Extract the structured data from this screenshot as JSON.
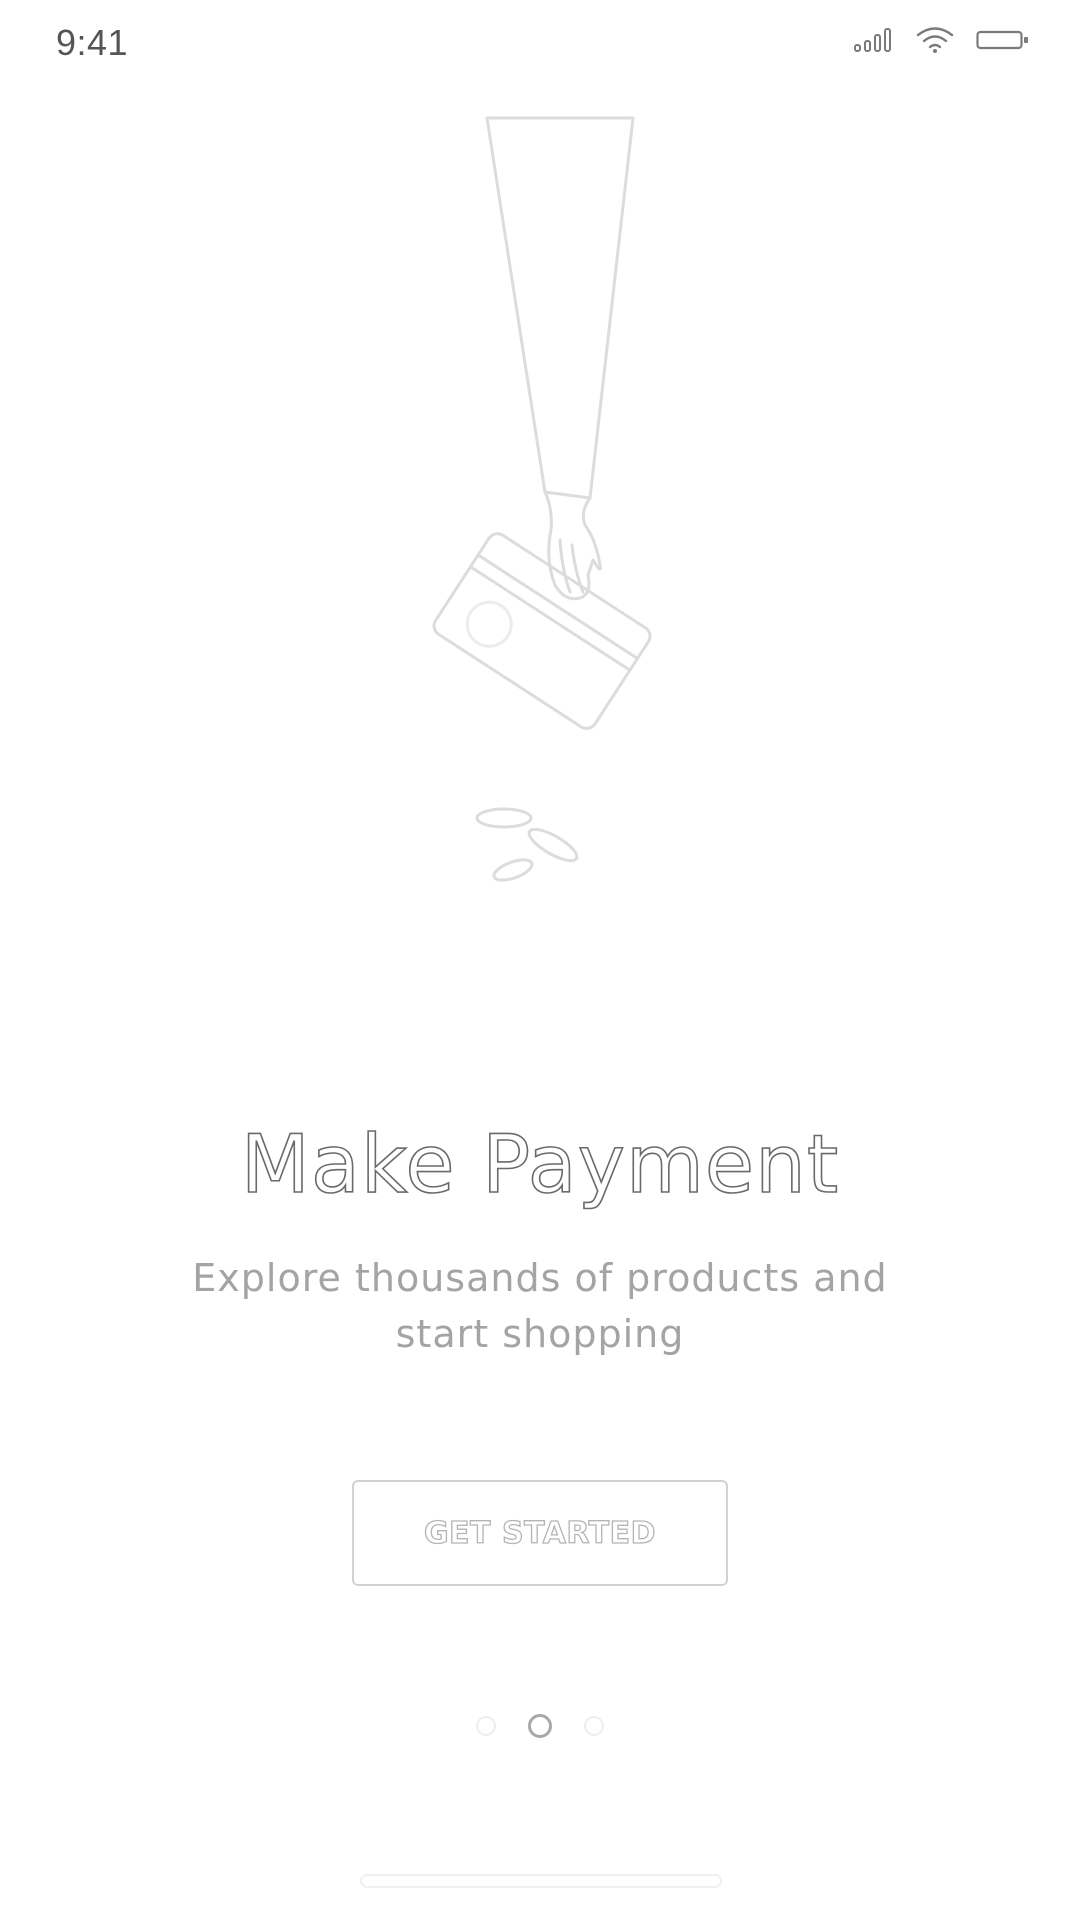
{
  "status_bar": {
    "time": "9:41",
    "icons": [
      "signal-icon",
      "wifi-icon",
      "battery-icon"
    ]
  },
  "illustration": {
    "subject": "hand-holding-card-icon",
    "extras": [
      "coins-icon"
    ]
  },
  "onboarding": {
    "title": "Make Payment",
    "subtitle": "Explore thousands of products and start shopping",
    "button_label": "GET STARTED"
  },
  "pagination": {
    "total": 3,
    "active_index": 1
  },
  "colors": {
    "background": "#ffffff",
    "title_outline": "#6a6a6a",
    "subtitle": "#a4a4a4",
    "button_border": "#d2d2d2",
    "dot_active": "#a8a8a8",
    "dot_inactive": "#eeeeee"
  }
}
